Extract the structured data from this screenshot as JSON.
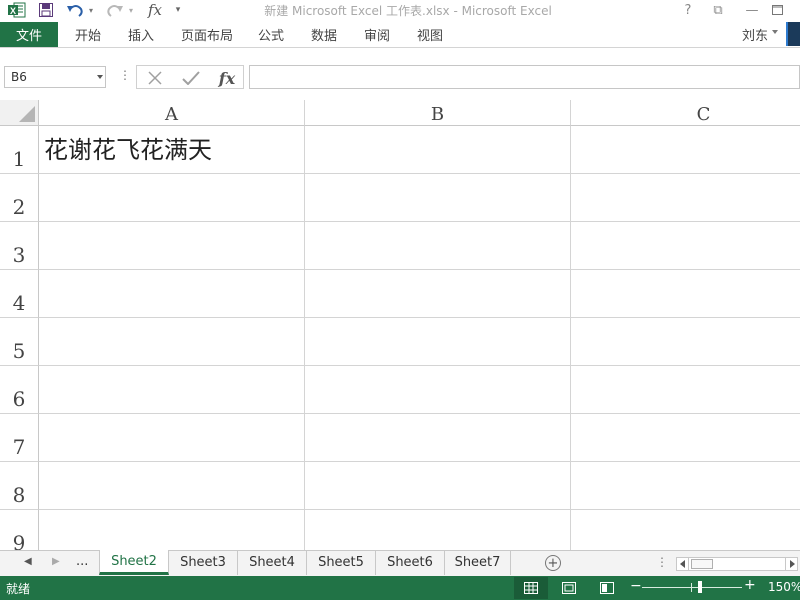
{
  "titlebar": {
    "title": "新建 Microsoft Excel 工作表.xlsx - Microsoft Excel",
    "quick_access": {
      "fx_label": "fx",
      "customize_label": "▾"
    },
    "controls": {
      "help": "?",
      "ribbon_display": "⧉",
      "minimize": "—"
    }
  },
  "ribbon": {
    "file_tab": "文件",
    "tabs": [
      {
        "label": "开始"
      },
      {
        "label": "插入"
      },
      {
        "label": "页面布局"
      },
      {
        "label": "公式"
      },
      {
        "label": "数据"
      },
      {
        "label": "审阅"
      },
      {
        "label": "视图"
      }
    ],
    "user": "刘东"
  },
  "formula_bar": {
    "name_box": "B6",
    "dots": "⋮",
    "cancel_icon": "close-icon",
    "enter_icon": "check-icon",
    "fx_label": "fx",
    "formula": ""
  },
  "grid": {
    "columns": [
      "A",
      "B",
      "C"
    ],
    "rows": [
      "1",
      "2",
      "3",
      "4",
      "5",
      "6",
      "7",
      "8",
      "9"
    ],
    "cells": {
      "A1": "花谢花飞花满天"
    },
    "selected_cell": "B6"
  },
  "sheet_tabs": {
    "ellipsis": "...",
    "tabs": [
      {
        "label": "Sheet2",
        "active": true
      },
      {
        "label": "Sheet3",
        "active": false
      },
      {
        "label": "Sheet4",
        "active": false
      },
      {
        "label": "Sheet5",
        "active": false
      },
      {
        "label": "Sheet6",
        "active": false
      },
      {
        "label": "Sheet7",
        "active": false
      }
    ],
    "add_label": "+"
  },
  "status_bar": {
    "status": "就绪",
    "zoom": "150%"
  },
  "colors": {
    "brand_green": "#217346",
    "active_tab_text": "#217346"
  }
}
